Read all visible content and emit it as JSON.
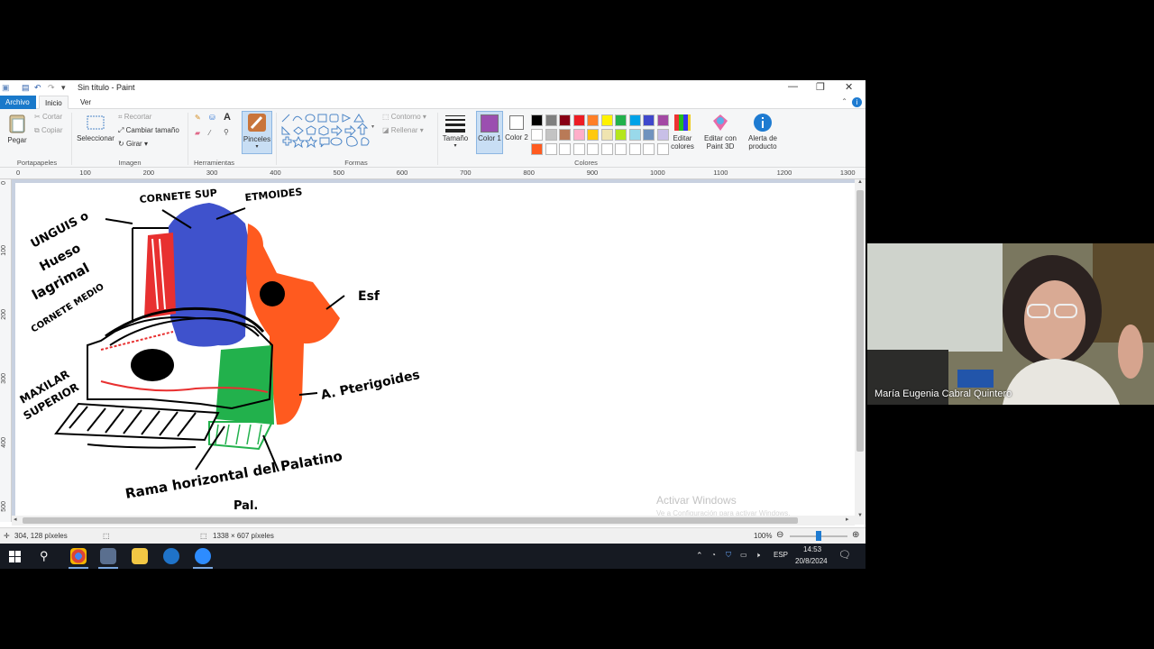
{
  "window": {
    "title": "Sin título - Paint"
  },
  "menu": {
    "file": "Archivo",
    "tabs": [
      "Inicio",
      "Ver"
    ]
  },
  "ribbon": {
    "clipboard": {
      "paste": "Pegar",
      "cut": "Cortar",
      "copy": "Copiar",
      "group": "Portapapeles"
    },
    "image": {
      "select": "Seleccionar",
      "crop": "Recortar",
      "resize": "Cambiar tamaño",
      "rotate": "Girar",
      "group": "Imagen"
    },
    "tools": {
      "group": "Herramientas"
    },
    "brushes": {
      "label": "Pinceles"
    },
    "shapes": {
      "outline": "Contorno",
      "fill": "Rellenar",
      "group": "Formas"
    },
    "size": {
      "label": "Tamaño"
    },
    "colors": {
      "color1": "Color 1",
      "color2": "Color 2",
      "edit": "Editar colores",
      "paint3d": "Editar con Paint 3D",
      "alert": "Alerta de producto",
      "group": "Colores",
      "color1_value": "#9b4fb0",
      "color2_value": "#ffffff",
      "palette": [
        "#000000",
        "#7f7f7f",
        "#880015",
        "#ed1c24",
        "#ff7f27",
        "#fff200",
        "#22b14c",
        "#00a2e8",
        "#3f48cc",
        "#a349a4",
        "#ffffff",
        "#c3c3c3",
        "#b97a57",
        "#ffaec9",
        "#ffc90e",
        "#efe4b0",
        "#b5e61d",
        "#99d9ea",
        "#7092be",
        "#c8bfe7",
        "#ff5a1f",
        "#ffffff",
        "#ffffff",
        "#ffffff",
        "#ffffff",
        "#ffffff",
        "#ffffff",
        "#ffffff",
        "#ffffff",
        "#ffffff"
      ]
    }
  },
  "ruler": {
    "h": [
      "0",
      "100",
      "200",
      "300",
      "400",
      "500",
      "600",
      "700",
      "800",
      "900",
      "1000",
      "1100",
      "1200",
      "1300"
    ],
    "v": [
      "0",
      "100",
      "200",
      "300",
      "400",
      "500"
    ]
  },
  "drawing": {
    "labels": {
      "cornete_sup": "CORNETE SUP",
      "etmoides": "ETMOIDES",
      "unguis_1": "UNGUIS o",
      "unguis_2": "Hueso",
      "unguis_3": "lagrimal",
      "cornete_medio": "CORNETE MEDIO",
      "esf": "Esf",
      "maxilar_1": "MAXILAR",
      "maxilar_2": "SUPERIOR",
      "pterigoides": "A. Pterigoides",
      "rama": "Rama horizontal del Palatino",
      "pal": "Pal."
    }
  },
  "watermark": {
    "line1": "Activar Windows",
    "line2": "Ve a Configuración para activar Windows."
  },
  "status": {
    "cursor": "304, 128 píxeles",
    "size": "1338 × 607 píxeles",
    "zoom": "100%"
  },
  "taskbar": {
    "lang": "ESP",
    "time": "14:53",
    "date": "20/8/2024"
  },
  "webcam": {
    "name": "María Eugenia Cabral Quintero"
  }
}
